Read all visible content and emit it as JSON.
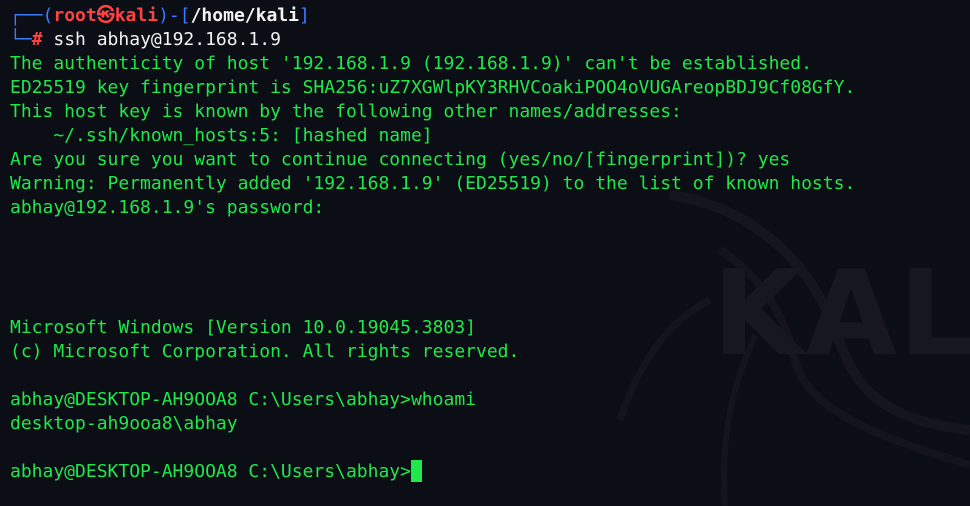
{
  "prompt": {
    "line1_prefix": "┌──(",
    "user": "root",
    "separator_icon": "㉿",
    "host": "kali",
    "mid": ")-[",
    "path": "/home/kali",
    "end_bracket": "]",
    "line2_prefix": "└─",
    "hash": "#",
    "command": " ssh abhay@192.168.1.9"
  },
  "ssh_output": [
    "The authenticity of host '192.168.1.9 (192.168.1.9)' can't be established.",
    "ED25519 key fingerprint is SHA256:uZ7XGWlpKY3RHVCoakiPOO4oVUGAreopBDJ9Cf08GfY.",
    "This host key is known by the following other names/addresses:",
    "    ~/.ssh/known_hosts:5: [hashed name]",
    "Are you sure you want to continue connecting (yes/no/[fingerprint])? yes",
    "Warning: Permanently added '192.168.1.9' (ED25519) to the list of known hosts.",
    "abhay@192.168.1.9's password:"
  ],
  "windows_banner": [
    "Microsoft Windows [Version 10.0.19045.3803]",
    "(c) Microsoft Corporation. All rights reserved."
  ],
  "session": {
    "prompt1": "abhay@DESKTOP-AH9OOA8 C:\\Users\\abhay>",
    "command1": "whoami",
    "output1": "desktop-ah9ooa8\\abhay",
    "prompt2": "abhay@DESKTOP-AH9OOA8 C:\\Users\\abhay>"
  },
  "watermark": {
    "text": "KALI"
  },
  "colors": {
    "terminal_green": "#1fe84a",
    "prompt_blue": "#3b7bff",
    "prompt_red": "#ff4343",
    "background": "#0c0e15"
  }
}
